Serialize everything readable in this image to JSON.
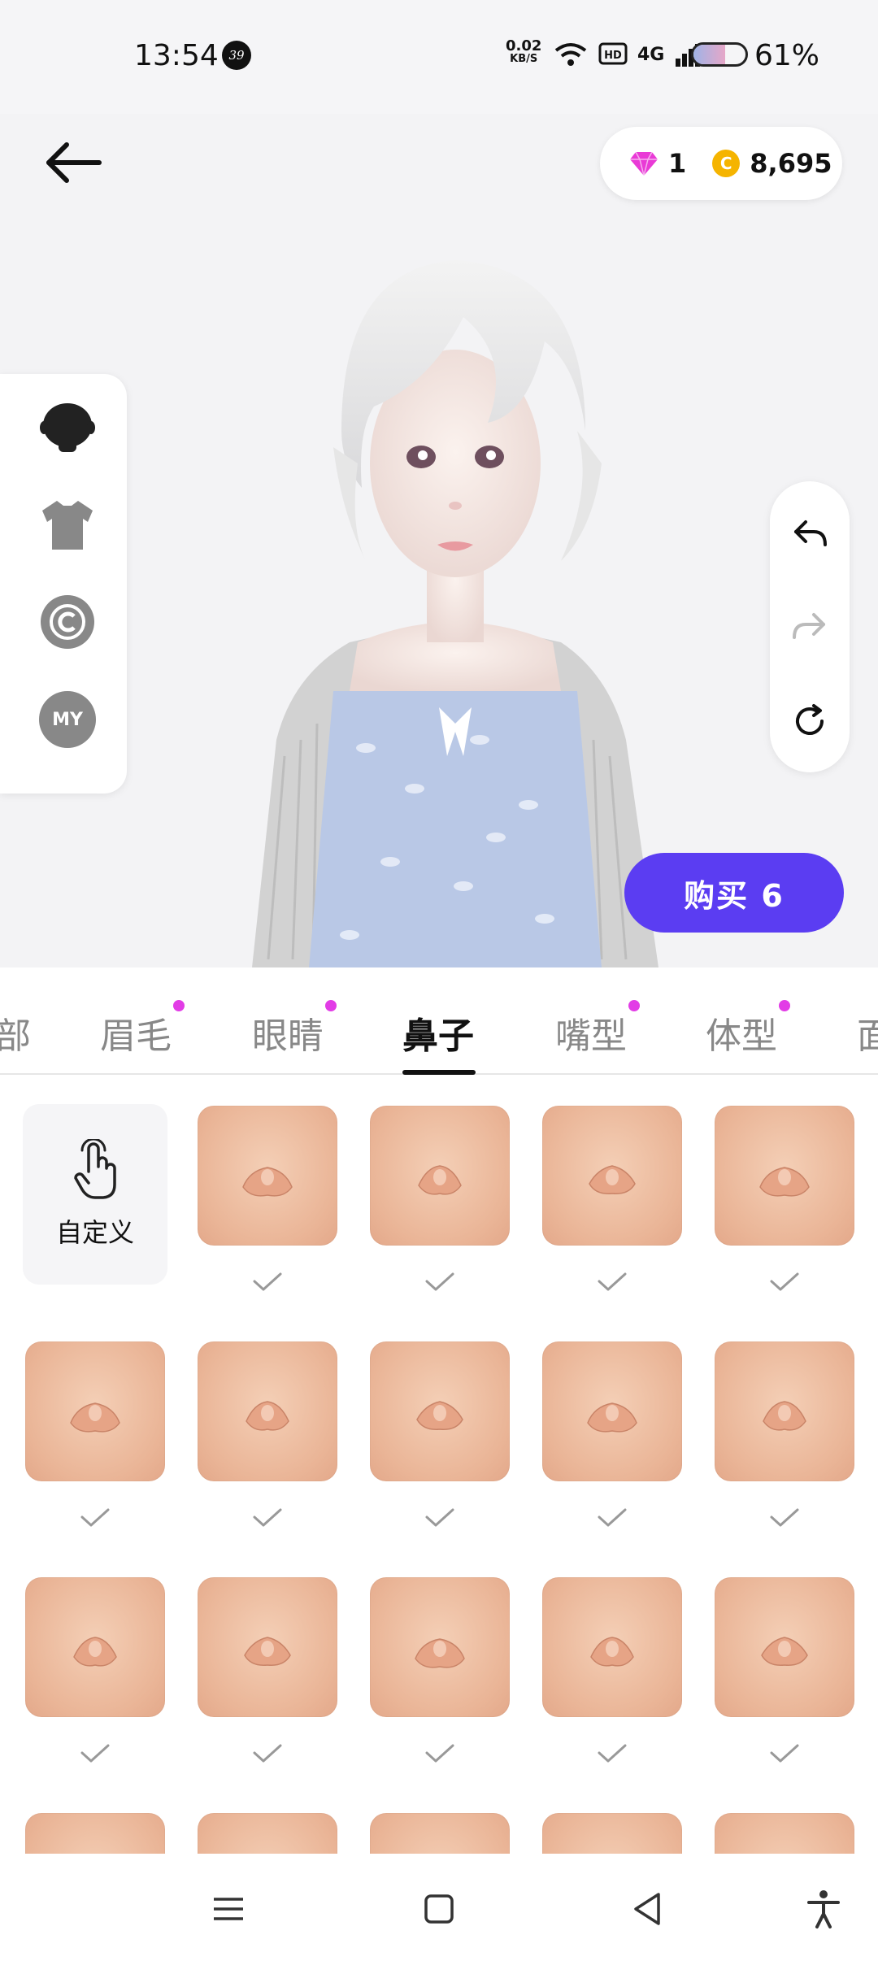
{
  "status_bar": {
    "time": "13:54",
    "notification_count": "39",
    "net_speed_value": "0.02",
    "net_speed_unit": "KB/S",
    "network_label": "4G",
    "battery_percent": "61%",
    "battery_level": 0.61
  },
  "header": {
    "gems": "1",
    "coins": "8,695",
    "coin_symbol": "C"
  },
  "side_menu": {
    "items": [
      {
        "icon": "head-icon"
      },
      {
        "icon": "shirt-icon"
      },
      {
        "icon": "copyright-icon"
      },
      {
        "icon": "my-icon",
        "label": "MY"
      }
    ]
  },
  "right_tools": [
    "undo-icon",
    "redo-icon",
    "reset-icon"
  ],
  "buy_button": {
    "label": "购买 6"
  },
  "tabs": [
    {
      "label": "部",
      "dot": false
    },
    {
      "label": "眉毛",
      "dot": true
    },
    {
      "label": "眼睛",
      "dot": true
    },
    {
      "label": "鼻子",
      "dot": false,
      "active": true
    },
    {
      "label": "嘴型",
      "dot": true
    },
    {
      "label": "体型",
      "dot": true
    },
    {
      "label": "面",
      "dot": false
    }
  ],
  "grid": {
    "custom_label": "自定义",
    "selected_check_count": 14
  },
  "colors": {
    "accent": "#5b3df2",
    "tab_dot": "#e23ce6",
    "gem": "#e93ad6",
    "coin": "#f5b400"
  }
}
